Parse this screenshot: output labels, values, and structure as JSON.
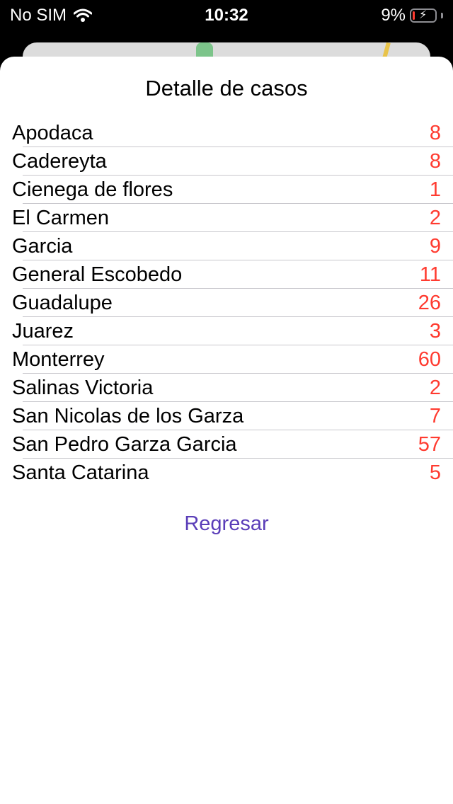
{
  "status_bar": {
    "carrier": "No SIM",
    "time": "10:32",
    "battery": "9%",
    "wifi_icon": "wifi-icon",
    "battery_icon": "battery-charging-icon"
  },
  "sheet": {
    "title": "Detalle de casos",
    "back_label": "Regresar",
    "count_color": "#ff3b30",
    "back_color": "#5a3db8",
    "rows": [
      {
        "name": "Apodaca",
        "count": "8"
      },
      {
        "name": "Cadereyta",
        "count": "8"
      },
      {
        "name": "Cienega de flores",
        "count": "1"
      },
      {
        "name": "El Carmen",
        "count": "2"
      },
      {
        "name": "Garcia",
        "count": "9"
      },
      {
        "name": "General Escobedo",
        "count": "11"
      },
      {
        "name": "Guadalupe",
        "count": "26"
      },
      {
        "name": "Juarez",
        "count": "3"
      },
      {
        "name": "Monterrey",
        "count": "60"
      },
      {
        "name": "Salinas Victoria",
        "count": "2"
      },
      {
        "name": "San Nicolas de los Garza",
        "count": "7"
      },
      {
        "name": "San Pedro Garza Garcia",
        "count": "57"
      },
      {
        "name": "Santa Catarina",
        "count": "5"
      }
    ]
  }
}
